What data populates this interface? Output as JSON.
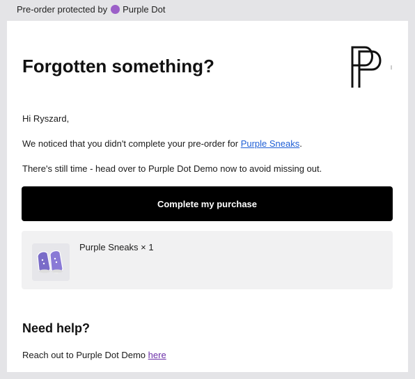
{
  "banner": {
    "prefix": "Pre-order protected by",
    "brand": "Purple Dot",
    "dot_color": "#9b5fc8"
  },
  "email": {
    "headline": "Forgotten something?",
    "greeting": "Hi Ryszard,",
    "notice_before": "We noticed that you didn't complete your pre-order for ",
    "notice_link": "Purple Sneaks",
    "notice_after": ".",
    "reminder": "There's still time - head over to Purple Dot Demo now to avoid missing out.",
    "cta_label": "Complete my purchase",
    "item": {
      "name": "Purple Sneaks × 1",
      "thumbnail_icon": "sneakers-image"
    },
    "help": {
      "title": "Need help?",
      "text_before": "Reach out to Purple Dot Demo ",
      "link": "here"
    }
  },
  "colors": {
    "cta_background": "#000000",
    "link_blue": "#1f5fd6",
    "link_visited": "#6b2fa8",
    "page_background": "#e4e4e7"
  }
}
